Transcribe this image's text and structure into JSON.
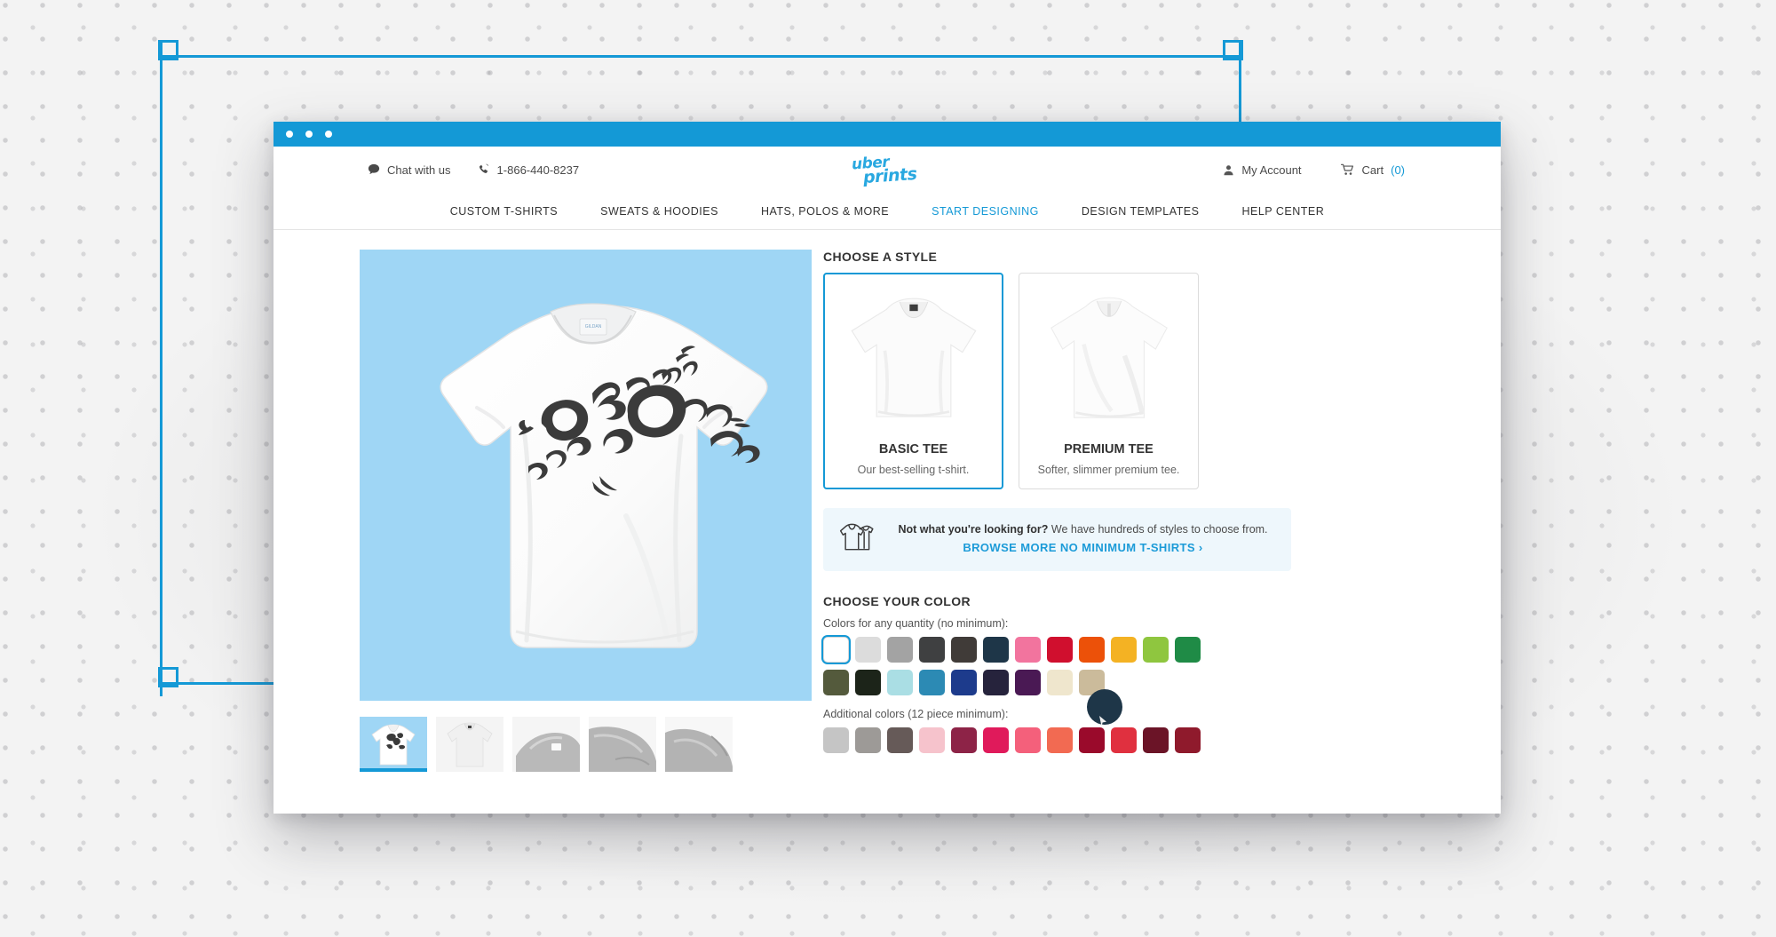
{
  "window": {
    "title_dots": 3,
    "titlebar_color": "#1499d6"
  },
  "header": {
    "chat_label": "Chat with us",
    "phone_label": "1-866-440-8237",
    "account_label": "My Account",
    "cart_label": "Cart",
    "cart_count": "(0)",
    "logo_line1": "uber",
    "logo_line2": "prints",
    "logo_color": "#29a8e0"
  },
  "nav": {
    "items": [
      {
        "label": "CUSTOM T-SHIRTS",
        "active": false
      },
      {
        "label": "SWEATS & HOODIES",
        "active": false
      },
      {
        "label": "HATS, POLOS & MORE",
        "active": false
      },
      {
        "label": "START DESIGNING",
        "active": true
      },
      {
        "label": "DESIGN TEMPLATES",
        "active": false
      },
      {
        "label": "HELP CENTER",
        "active": false
      }
    ],
    "active_color": "#1499d6"
  },
  "gallery": {
    "hero_background": "#9fd6f5",
    "hero_art_text": "Design Your Own",
    "thumbnails": [
      {
        "name": "front-with-design",
        "selected": true
      },
      {
        "name": "plain-front",
        "selected": false
      },
      {
        "name": "collar-detail",
        "selected": false
      },
      {
        "name": "sleeve-detail",
        "selected": false
      },
      {
        "name": "fabric-detail",
        "selected": false
      }
    ]
  },
  "style_section": {
    "title": "CHOOSE A STYLE",
    "cards": [
      {
        "name": "BASIC TEE",
        "desc": "Our best-selling t-shirt.",
        "selected": true
      },
      {
        "name": "PREMIUM TEE",
        "desc": "Softer, slimmer premium tee.",
        "selected": false
      }
    ]
  },
  "promo": {
    "lead": "Not what you're looking for?",
    "tail": " We have hundreds of styles to choose from.",
    "cta": "BROWSE MORE NO MINIMUM T-SHIRTS ›",
    "background": "#eef7fc",
    "cta_color": "#1c9bd8"
  },
  "color_section": {
    "title": "CHOOSE YOUR COLOR",
    "any_quantity_label": "Colors for any quantity (no minimum):",
    "additional_label": "Additional colors (12 piece minimum):",
    "any_quantity_row1": [
      {
        "hex": "#ffffff",
        "selected": true
      },
      {
        "hex": "#dcdcdc",
        "selected": false
      },
      {
        "hex": "#a3a3a3",
        "selected": false
      },
      {
        "hex": "#3f4041",
        "selected": false
      },
      {
        "hex": "#403b38",
        "selected": false
      },
      {
        "hex": "#1e3648",
        "selected": false
      },
      {
        "hex": "#f2749e",
        "selected": false
      },
      {
        "hex": "#d00f2e",
        "selected": false
      },
      {
        "hex": "#ec5109",
        "selected": false
      },
      {
        "hex": "#f4b223",
        "selected": false
      },
      {
        "hex": "#8fc63f",
        "selected": false
      },
      {
        "hex": "#1f8b46",
        "selected": false
      }
    ],
    "any_quantity_row2": [
      {
        "hex": "#545a3c",
        "selected": false
      },
      {
        "hex": "#1c2419",
        "selected": false
      },
      {
        "hex": "#aadee4",
        "selected": false
      },
      {
        "hex": "#2c8ab4",
        "selected": false
      },
      {
        "hex": "#1d3b8c",
        "selected": false
      },
      {
        "hex": "#26233c",
        "selected": false
      },
      {
        "hex": "#4a1954",
        "selected": false
      },
      {
        "hex": "#efe6cd",
        "selected": false
      },
      {
        "hex": "#cbbb9b",
        "selected": false
      }
    ],
    "additional_row1": [
      {
        "hex": "#c5c5c5",
        "selected": false
      },
      {
        "hex": "#9d9a97",
        "selected": false
      },
      {
        "hex": "#665a58",
        "selected": false
      },
      {
        "hex": "#f6c3cc",
        "selected": false
      },
      {
        "hex": "#8d2347",
        "selected": false
      },
      {
        "hex": "#e01a5b",
        "selected": false
      },
      {
        "hex": "#f4607b",
        "selected": false
      },
      {
        "hex": "#f26a52",
        "selected": false
      },
      {
        "hex": "#9a0a2b",
        "selected": false
      },
      {
        "hex": "#e0303f",
        "selected": false
      },
      {
        "hex": "#6b1427",
        "selected": false
      },
      {
        "hex": "#8f1a2c",
        "selected": false
      }
    ]
  },
  "frame": {
    "color": "#1499d6"
  }
}
